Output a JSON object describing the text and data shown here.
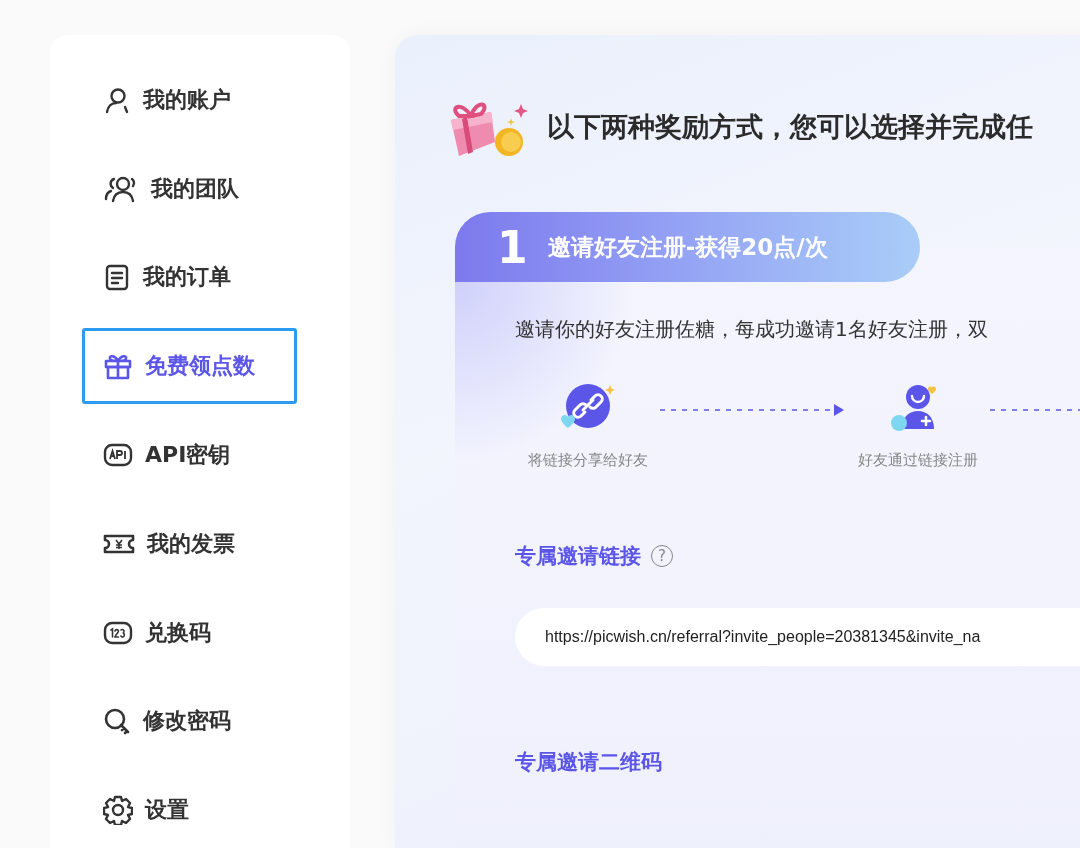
{
  "sidebar": {
    "items": [
      {
        "kind": "account",
        "label": "我的账户",
        "selected": false
      },
      {
        "kind": "team",
        "label": "我的团队",
        "selected": false
      },
      {
        "kind": "orders",
        "label": "我的订单",
        "selected": false
      },
      {
        "kind": "gift",
        "label": "免费领点数",
        "selected": true
      },
      {
        "kind": "api",
        "label": "API密钥",
        "selected": false
      },
      {
        "kind": "invoice",
        "label": "我的发票",
        "selected": false
      },
      {
        "kind": "code",
        "label": "兑换码",
        "selected": false
      },
      {
        "kind": "password",
        "label": "修改密码",
        "selected": false
      },
      {
        "kind": "settings",
        "label": "设置",
        "selected": false
      }
    ]
  },
  "main": {
    "title": "以下两种奖励方式，您可以选择并完成任",
    "card": {
      "number": "1",
      "title": "邀请好友注册-获得20点/次",
      "description": "邀请你的好友注册佐糖，每成功邀请1名好友注册，双",
      "steps": [
        {
          "kind": "share",
          "label": "将链接分享给好友"
        },
        {
          "kind": "register",
          "label": "好友通过链接注册"
        }
      ],
      "link_heading": "专属邀请链接",
      "help_icon": "?",
      "link": "https://picwish.cn/referral?invite_people=20381345&invite_na",
      "qr_heading": "专属邀请二维码"
    }
  }
}
